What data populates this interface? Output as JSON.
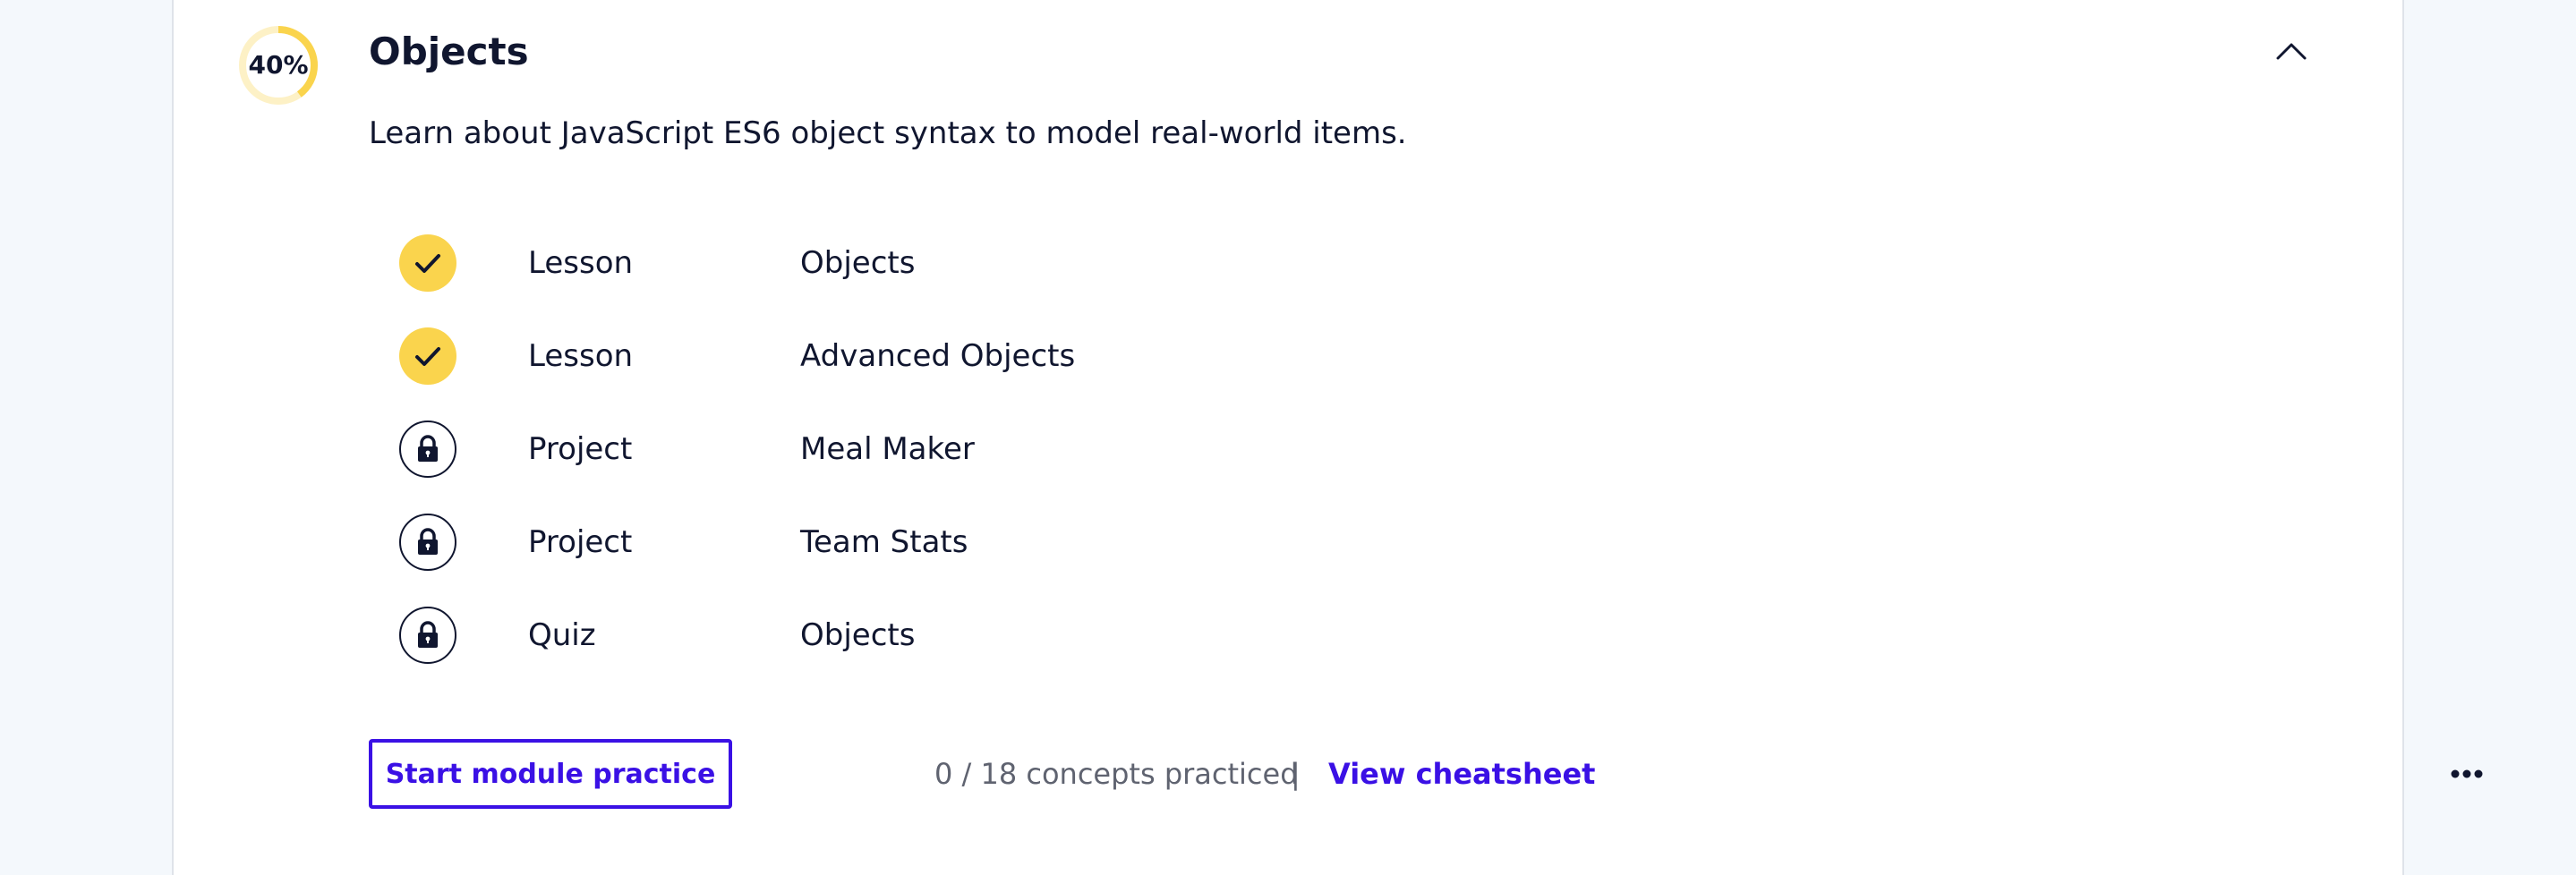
{
  "module": {
    "title": "Objects",
    "progress_label": "40%",
    "progress_fraction": 0.4,
    "description": "Learn about JavaScript ES6 object syntax to model real-world items."
  },
  "items": [
    {
      "type": "Lesson",
      "name": "Objects",
      "status": "completed",
      "icon": "check-icon"
    },
    {
      "type": "Lesson",
      "name": "Advanced Objects",
      "status": "completed",
      "icon": "check-icon"
    },
    {
      "type": "Project",
      "name": "Meal Maker",
      "status": "locked",
      "icon": "lock-icon"
    },
    {
      "type": "Project",
      "name": "Team Stats",
      "status": "locked",
      "icon": "lock-icon"
    },
    {
      "type": "Quiz",
      "name": "Objects",
      "status": "locked",
      "icon": "lock-icon"
    }
  ],
  "footer": {
    "practice_button_label": "Start module practice",
    "concepts_text": "0 / 18 concepts practiced",
    "separator": "|",
    "cheatsheet_label": "View cheatsheet"
  },
  "colors": {
    "accent": "#3a10e5",
    "progress": "#fad44d",
    "progress_track": "#fdf1c6",
    "text": "#10162f",
    "muted": "#5f6370",
    "background": "#f4f8fc"
  },
  "icons": {
    "collapse": "chevron-up-icon",
    "more": "more-horizontal-icon"
  }
}
